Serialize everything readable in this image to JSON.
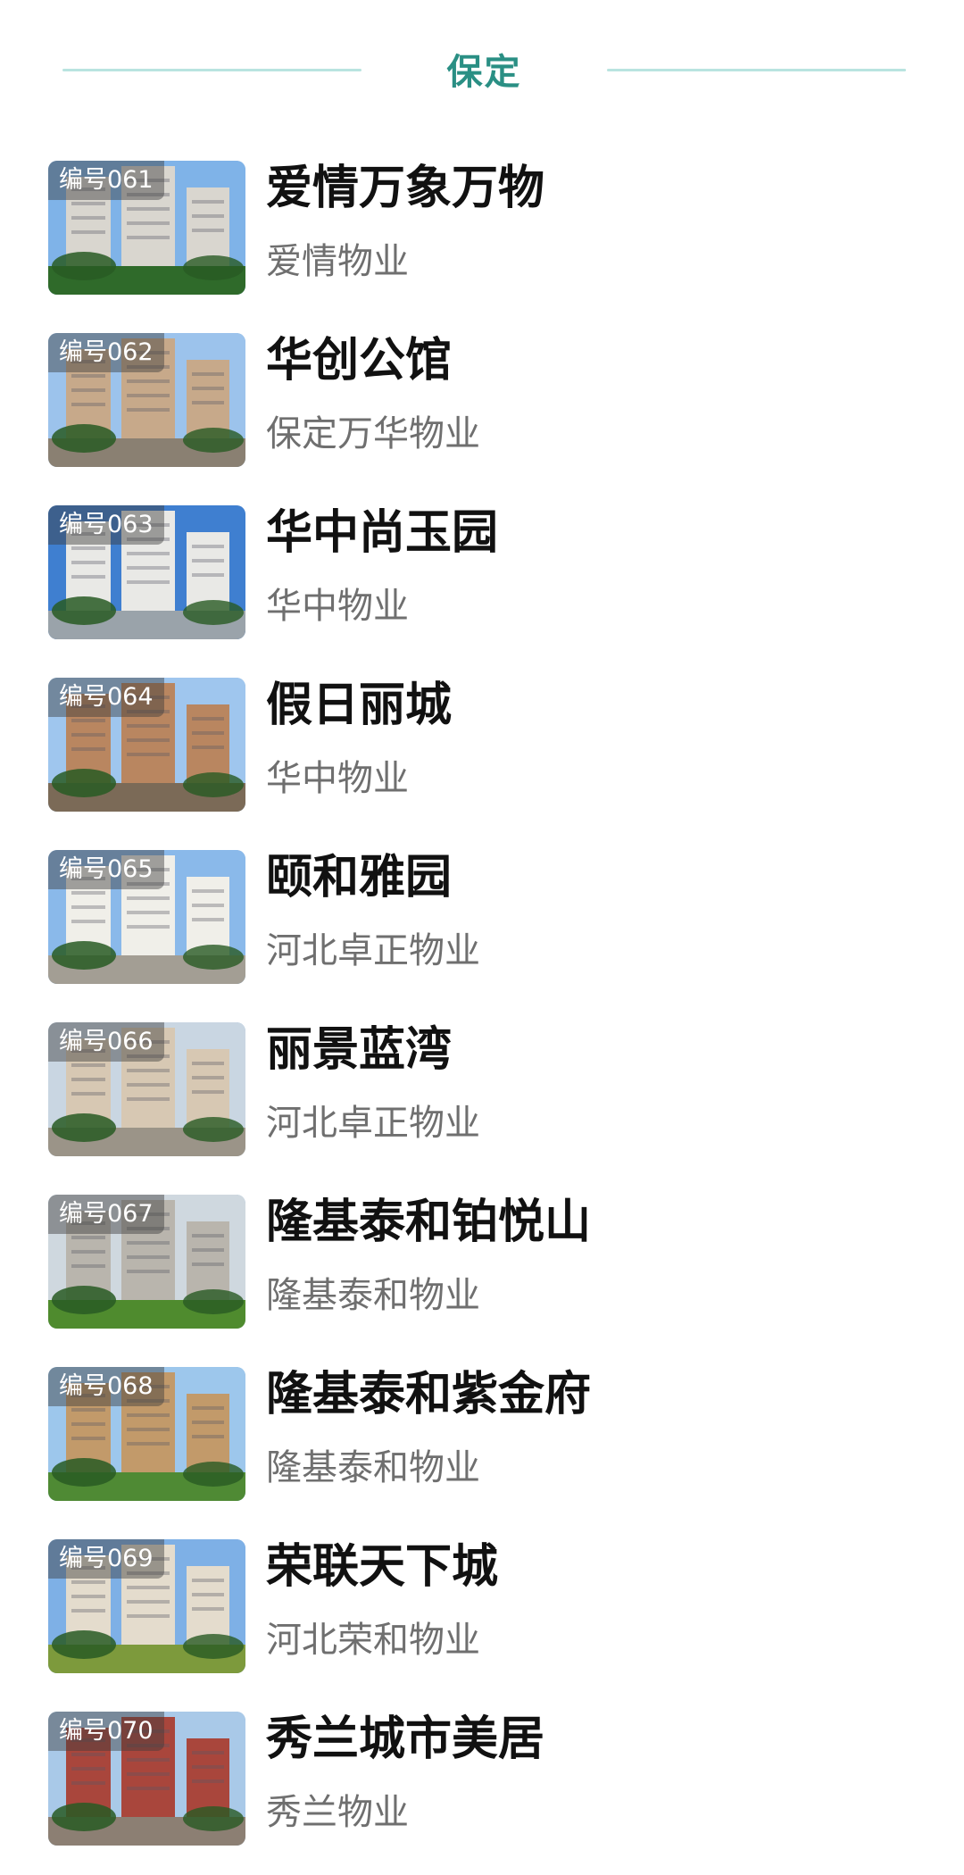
{
  "header": {
    "title": "保定"
  },
  "items": [
    {
      "badge": "编号061",
      "title": "爱情万象万物",
      "company": "爱情物业",
      "scene": {
        "sky": "#7fb3e8",
        "ground": "#2f6a2a",
        "building": "#d9d6cf"
      }
    },
    {
      "badge": "编号062",
      "title": "华创公馆",
      "company": "保定万华物业",
      "scene": {
        "sky": "#9cc3ec",
        "ground": "#8a8072",
        "building": "#c7a98a"
      }
    },
    {
      "badge": "编号063",
      "title": "华中尚玉园",
      "company": "华中物业",
      "scene": {
        "sky": "#3f7fd0",
        "ground": "#9aa3aa",
        "building": "#e9e9e6"
      }
    },
    {
      "badge": "编号064",
      "title": "假日丽城",
      "company": "华中物业",
      "scene": {
        "sky": "#9fc6ee",
        "ground": "#7b6a57",
        "building": "#b98660"
      }
    },
    {
      "badge": "编号065",
      "title": "颐和雅园",
      "company": "河北卓正物业",
      "scene": {
        "sky": "#8ab9ea",
        "ground": "#a39e94",
        "building": "#f0efe9"
      }
    },
    {
      "badge": "编号066",
      "title": "丽景蓝湾",
      "company": "河北卓正物业",
      "scene": {
        "sky": "#c9d6e2",
        "ground": "#9b9488",
        "building": "#d7c8b3"
      }
    },
    {
      "badge": "编号067",
      "title": "隆基泰和铂悦山",
      "company": "隆基泰和物业",
      "scene": {
        "sky": "#cfd8df",
        "ground": "#4f8b2e",
        "building": "#b9b5ad"
      }
    },
    {
      "badge": "编号068",
      "title": "隆基泰和紫金府",
      "company": "隆基泰和物业",
      "scene": {
        "sky": "#9dc7ec",
        "ground": "#4f8a34",
        "building": "#c29a6a"
      }
    },
    {
      "badge": "编号069",
      "title": "荣联天下城",
      "company": "河北荣和物业",
      "scene": {
        "sky": "#7eb0e6",
        "ground": "#7d9a3c",
        "building": "#e4dccd"
      }
    },
    {
      "badge": "编号070",
      "title": "秀兰城市美居",
      "company": "秀兰物业",
      "scene": {
        "sky": "#a9c9e8",
        "ground": "#8c7f73",
        "building": "#a9463c"
      }
    }
  ]
}
